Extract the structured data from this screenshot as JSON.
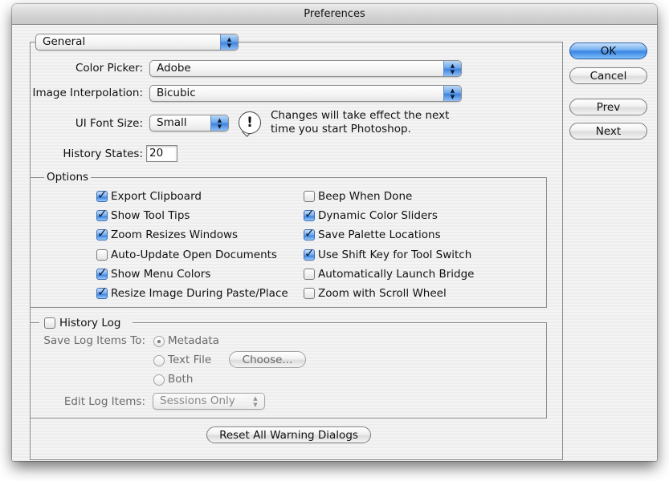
{
  "window": {
    "title": "Preferences"
  },
  "section_popup": {
    "value": "General"
  },
  "fields": {
    "color_picker": {
      "label": "Color Picker:",
      "value": "Adobe"
    },
    "image_interpolation": {
      "label": "Image Interpolation:",
      "value": "Bicubic"
    },
    "ui_font_size": {
      "label": "UI Font Size:",
      "value": "Small"
    },
    "history_states": {
      "label": "History States:",
      "value": "20"
    }
  },
  "notice": {
    "icon": "exclamation-icon",
    "line1": "Changes will take effect the next",
    "line2": "time you start Photoshop."
  },
  "options": {
    "title": "Options",
    "left": [
      {
        "label": "Export Clipboard",
        "checked": true
      },
      {
        "label": "Show Tool Tips",
        "checked": true
      },
      {
        "label": "Zoom Resizes Windows",
        "checked": true
      },
      {
        "label": "Auto-Update Open Documents",
        "checked": false
      },
      {
        "label": "Show Menu Colors",
        "checked": true
      },
      {
        "label": "Resize Image During Paste/Place",
        "checked": true
      }
    ],
    "right": [
      {
        "label": "Beep When Done",
        "checked": false
      },
      {
        "label": "Dynamic Color Sliders",
        "checked": true
      },
      {
        "label": "Save Palette Locations",
        "checked": true
      },
      {
        "label": "Use Shift Key for Tool Switch",
        "checked": true
      },
      {
        "label": "Automatically Launch Bridge",
        "checked": false
      },
      {
        "label": "Zoom with Scroll Wheel",
        "checked": false
      }
    ]
  },
  "history_log": {
    "title": "History Log",
    "checked": false,
    "save_label": "Save Log Items To:",
    "radios": [
      {
        "label": "Metadata",
        "selected": true
      },
      {
        "label": "Text File",
        "selected": false
      },
      {
        "label": "Both",
        "selected": false
      }
    ],
    "choose_button": "Choose...",
    "edit_label": "Edit Log Items:",
    "edit_value": "Sessions Only"
  },
  "reset_button": "Reset All Warning Dialogs",
  "buttons": {
    "ok": "OK",
    "cancel": "Cancel",
    "prev": "Prev",
    "next": "Next"
  },
  "colors": {
    "accent": "#3a86e3",
    "window_bg": "#f0f0f0"
  }
}
